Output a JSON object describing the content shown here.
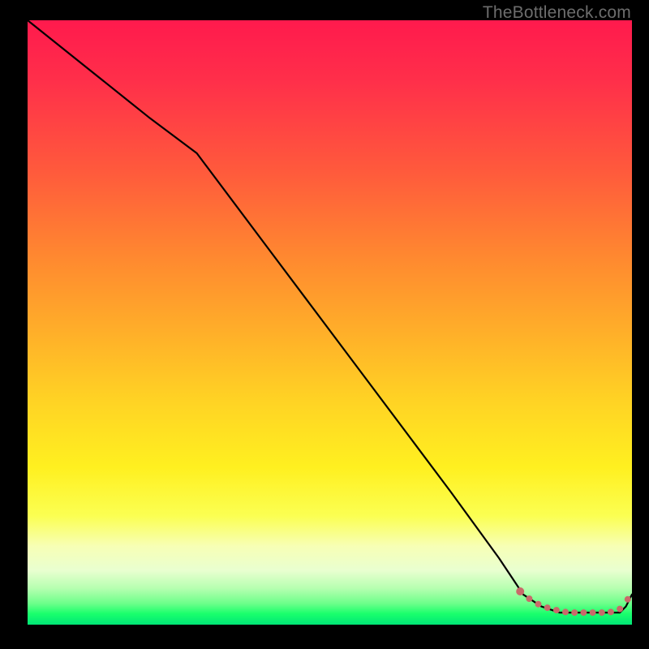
{
  "attribution": "TheBottleneck.com",
  "chart_data": {
    "type": "line",
    "title": "",
    "xlabel": "",
    "ylabel": "",
    "xlim": [
      0,
      100
    ],
    "ylim": [
      0,
      100
    ],
    "series": [
      {
        "name": "bottleneck-curve",
        "x": [
          0,
          10,
          20,
          28,
          40,
          55,
          70,
          78,
          82,
          85,
          88,
          90,
          92,
          94,
          96,
          98,
          99,
          100
        ],
        "y": [
          100,
          92,
          84,
          78,
          62,
          42,
          22,
          11,
          5,
          3,
          2,
          2,
          2,
          2,
          2,
          2,
          3,
          5
        ]
      }
    ],
    "markers": {
      "name": "highlight-points",
      "x": [
        81.5,
        83,
        84.5,
        86,
        87.5,
        89,
        90.5,
        92,
        93.5,
        95,
        96.5,
        98,
        99.3
      ],
      "y": [
        5.5,
        4.3,
        3.4,
        2.8,
        2.4,
        2.1,
        2.0,
        2.0,
        2.0,
        2.0,
        2.1,
        2.6,
        4.2
      ],
      "radius_first": 5,
      "radius_rest": 4,
      "color": "#c96a6a"
    },
    "colors": {
      "line": "#000000",
      "marker": "#c96a6a",
      "gradient_top": "#ff1a4d",
      "gradient_mid": "#ffd324",
      "gradient_bottom": "#00e676",
      "background": "#000000",
      "attribution_text": "#6d6d6d"
    }
  }
}
